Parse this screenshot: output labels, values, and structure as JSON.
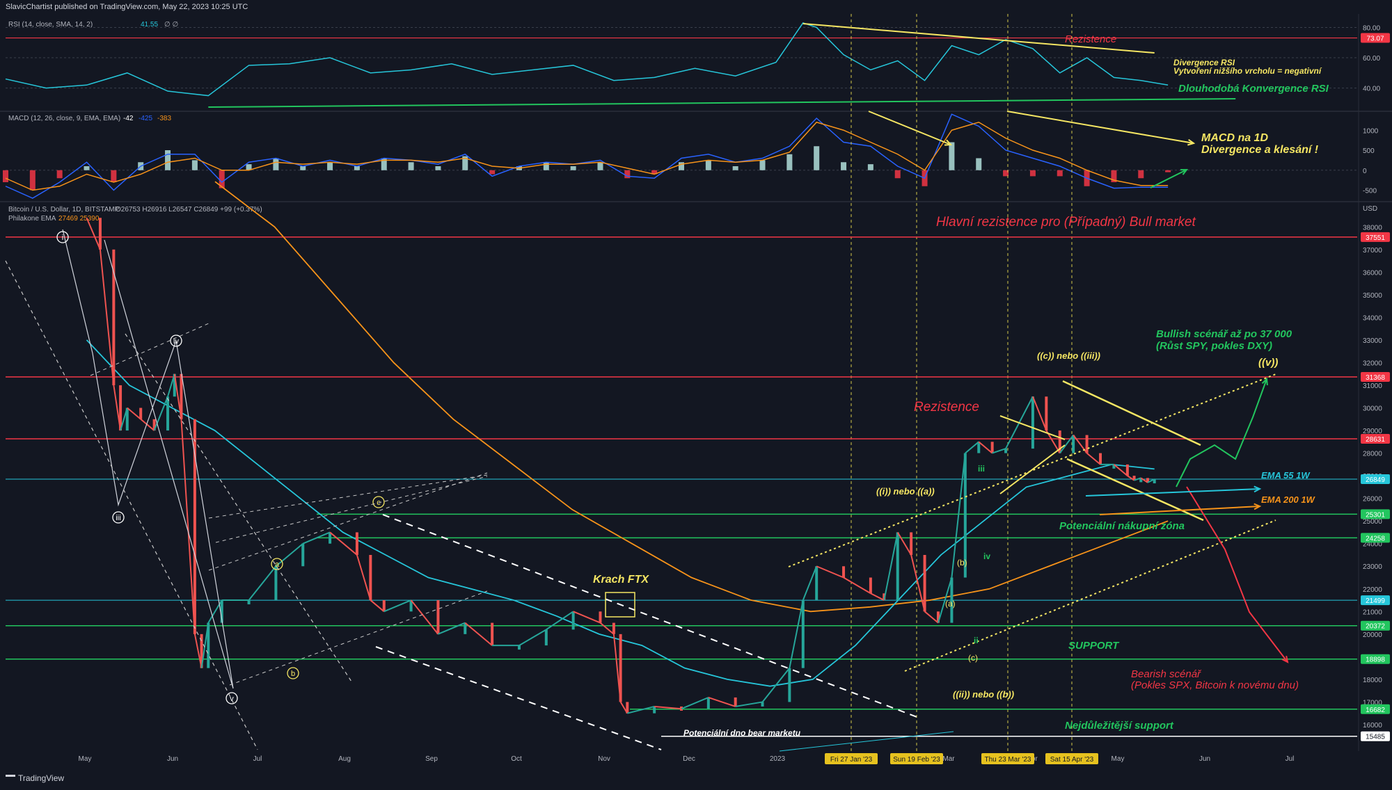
{
  "header": {
    "publisher": "SlavicChartist published on TradingView.com, May 22, 2023 10:25 UTC",
    "brand": "TradingView"
  },
  "colors": {
    "bg": "#131722",
    "red": "#f23645",
    "green": "#22c55e",
    "yellow": "#f5e663",
    "cyan": "#26c6da",
    "orange": "#f7931a",
    "white": "#ffffff",
    "grid": "#2a2e39",
    "text": "#b2b5be"
  },
  "chart_data": [
    {
      "type": "line",
      "panel": "rsi",
      "title": "RSI (14, close, SMA, 14, 2)",
      "value_label": "41.55",
      "extra_label": "∅ ∅",
      "yticks": [
        40,
        60,
        80
      ],
      "ytick_labels": [
        "40.00",
        "60.00",
        "80.00"
      ],
      "ylim": [
        27,
        88
      ],
      "resistance_level": 73.07,
      "resistance_label": "73.07",
      "x": [
        0,
        0.03,
        0.06,
        0.09,
        0.12,
        0.15,
        0.18,
        0.21,
        0.24,
        0.27,
        0.3,
        0.33,
        0.36,
        0.39,
        0.42,
        0.45,
        0.48,
        0.51,
        0.54,
        0.57,
        0.59,
        0.6,
        0.62,
        0.64,
        0.66,
        0.68,
        0.7,
        0.72,
        0.74,
        0.76,
        0.78,
        0.8,
        0.82,
        0.84,
        0.86
      ],
      "values": [
        46,
        40,
        42,
        50,
        38,
        35,
        55,
        56,
        60,
        50,
        52,
        56,
        49,
        52,
        55,
        45,
        47,
        53,
        48,
        57,
        83,
        80,
        62,
        52,
        58,
        45,
        68,
        62,
        72,
        66,
        50,
        60,
        47,
        45,
        42
      ]
    },
    {
      "type": "bar",
      "panel": "macd",
      "title": "MACD (12, 26, close, 9, EMA, EMA)",
      "values_label": [
        "-42",
        "-425",
        "-383"
      ],
      "yticks": [
        1000,
        500,
        0,
        -500
      ],
      "ytick_labels": [
        "1000",
        "500",
        "0",
        "-500"
      ],
      "ylim": [
        -700,
        1300
      ],
      "x": [
        0,
        0.02,
        0.04,
        0.06,
        0.08,
        0.1,
        0.12,
        0.14,
        0.16,
        0.18,
        0.2,
        0.22,
        0.24,
        0.26,
        0.28,
        0.3,
        0.32,
        0.34,
        0.36,
        0.38,
        0.4,
        0.42,
        0.44,
        0.46,
        0.48,
        0.5,
        0.52,
        0.54,
        0.56,
        0.58,
        0.6,
        0.62,
        0.64,
        0.66,
        0.68,
        0.7,
        0.72,
        0.74,
        0.76,
        0.78,
        0.8,
        0.82,
        0.84,
        0.86
      ],
      "histogram": [
        -300,
        -500,
        -200,
        100,
        -300,
        200,
        500,
        250,
        -450,
        150,
        300,
        100,
        200,
        100,
        300,
        200,
        100,
        350,
        -100,
        100,
        200,
        100,
        200,
        -200,
        -100,
        200,
        250,
        100,
        250,
        400,
        600,
        200,
        150,
        -200,
        -400,
        700,
        300,
        -150,
        -150,
        -150,
        -400,
        -300,
        -200,
        -50
      ],
      "macd": [
        -400,
        -700,
        -300,
        200,
        -500,
        100,
        400,
        400,
        -300,
        200,
        300,
        100,
        250,
        100,
        300,
        250,
        150,
        400,
        -150,
        100,
        200,
        150,
        250,
        -150,
        -200,
        300,
        400,
        200,
        300,
        600,
        1300,
        700,
        600,
        100,
        -200,
        1400,
        1100,
        500,
        300,
        100,
        -200,
        -450,
        -425,
        -425
      ],
      "signal": [
        -200,
        -500,
        -400,
        -100,
        -300,
        -100,
        200,
        300,
        0,
        0,
        200,
        150,
        200,
        150,
        250,
        250,
        200,
        300,
        100,
        50,
        150,
        150,
        200,
        50,
        -100,
        150,
        250,
        200,
        250,
        450,
        1200,
        1000,
        700,
        400,
        0,
        1000,
        1200,
        800,
        500,
        300,
        0,
        -250,
        -383,
        -383
      ]
    },
    {
      "type": "line",
      "panel": "price",
      "title": "Bitcoin / U.S. Dollar, 1D, BITSTAMP",
      "ohlc_label": "O26753 H26916 L26547 C26849 +99 (+0.37%)",
      "ema_label": "Philakone EMA",
      "ema_values": "27469 25390",
      "currency": "USD",
      "yticks": [
        16000,
        17000,
        18000,
        19000,
        20000,
        21000,
        22000,
        23000,
        24000,
        25000,
        26000,
        27000,
        28000,
        29000,
        30000,
        31000,
        32000,
        33000,
        34000,
        35000,
        36000,
        37000,
        38000
      ],
      "ylim": [
        15200,
        38500
      ],
      "xticks": [
        "May",
        "Jun",
        "Jul",
        "Aug",
        "Sep",
        "Oct",
        "Nov",
        "Dec",
        "2023",
        "Feb",
        "Mar",
        "Apr",
        "May",
        "Jun",
        "Jul"
      ],
      "date_markers": [
        "Fri 27 Jan '23",
        "Sun 19 Feb '23",
        "Thu 23 Mar '23",
        "Sat 15 Apr '23"
      ],
      "levels": [
        {
          "value": 37551,
          "label": "37551",
          "color": "red"
        },
        {
          "value": 31368,
          "label": "31368",
          "color": "red"
        },
        {
          "value": 28631,
          "label": "28631",
          "color": "red"
        },
        {
          "value": 26849,
          "label": "26849",
          "color": "cyan"
        },
        {
          "value": 25301,
          "label": "25301",
          "color": "green"
        },
        {
          "value": 24258,
          "label": "24258",
          "color": "green"
        },
        {
          "value": 21499,
          "label": "21499",
          "color": "cyan"
        },
        {
          "value": 20372,
          "label": "20372",
          "color": "green"
        },
        {
          "value": 18898,
          "label": "18898",
          "color": "green"
        },
        {
          "value": 16682,
          "label": "16682",
          "color": "green"
        },
        {
          "value": 15485,
          "label": "15485",
          "color": "white"
        }
      ],
      "x": [
        0.06,
        0.07,
        0.08,
        0.085,
        0.09,
        0.1,
        0.11,
        0.12,
        0.125,
        0.13,
        0.14,
        0.145,
        0.15,
        0.16,
        0.18,
        0.2,
        0.22,
        0.24,
        0.26,
        0.27,
        0.28,
        0.3,
        0.32,
        0.34,
        0.36,
        0.38,
        0.4,
        0.42,
        0.44,
        0.45,
        0.455,
        0.46,
        0.48,
        0.5,
        0.52,
        0.54,
        0.56,
        0.58,
        0.59,
        0.6,
        0.62,
        0.64,
        0.65,
        0.66,
        0.67,
        0.68,
        0.69,
        0.7,
        0.71,
        0.72,
        0.73,
        0.74,
        0.76,
        0.77,
        0.78,
        0.79,
        0.8,
        0.81,
        0.82,
        0.83,
        0.835,
        0.84,
        0.845,
        0.85
      ],
      "values": [
        38400,
        37000,
        31000,
        29000,
        30000,
        29500,
        29000,
        30500,
        31500,
        29500,
        20000,
        18500,
        20500,
        21500,
        21500,
        23000,
        24000,
        24500,
        23500,
        21500,
        21000,
        21500,
        20000,
        20500,
        19500,
        19500,
        20200,
        21000,
        20500,
        20000,
        17000,
        16500,
        16800,
        16700,
        17200,
        16800,
        17000,
        18500,
        21500,
        23000,
        22500,
        21800,
        21500,
        24500,
        23500,
        21000,
        20500,
        22500,
        28000,
        28500,
        28000,
        28200,
        30500,
        29000,
        28000,
        28800,
        28000,
        27500,
        27500,
        27000,
        26800,
        26900,
        26700,
        26849
      ],
      "ema55": [
        33000,
        31000,
        30000,
        29000,
        27500,
        26000,
        24500,
        23500,
        22500,
        22000,
        21500,
        20800,
        20000,
        19500,
        18500,
        18000,
        17700,
        18000,
        19500,
        21500,
        23500,
        25000,
        26500,
        27000,
        27500,
        27300
      ],
      "ema200": [
        40000,
        38000,
        35000,
        32000,
        29500,
        27500,
        25500,
        24000,
        22500,
        21500,
        21000,
        21200,
        21500,
        22000,
        23000,
        24000,
        25000
      ]
    }
  ],
  "annotations": {
    "rsi_resistance": "Rezistence",
    "rsi_divergence_1": "Divergence RSI",
    "rsi_divergence_2": "Vytvoření nižšího vrcholu = negativní",
    "rsi_convergence": "Dlouhodobá Konvergence RSI",
    "macd_div_1": "MACD na 1D",
    "macd_div_2": "Divergence a klesání !",
    "main_resistance": "Hlavní rezistence pro (Případný) Bull market",
    "resistance": "Rezistence",
    "bullish_1": "Bullish scénář až po 37 000",
    "bullish_2": "(Růst SPY, pokles DXY)",
    "wave_v": "((v))",
    "wave_c_iii": "((c)) nebo ((iii))",
    "wave_i_a": "((i)) nebo ((a))",
    "wave_ii_b": "((ii)) nebo ((b))",
    "ema55": "EMA 55 1W",
    "ema200": "EMA 200 1W",
    "buy_zone": "Potenciální nákupní zóna",
    "support": "SUPPORT",
    "bearish_1": "Bearish scénář",
    "bearish_2": "(Pokles SPX, Bitcoin k novému dnu)",
    "most_support": "Nejdůležitější support",
    "bear_bottom": "Potenciální dno bear marketu",
    "ftx": "Krach FTX",
    "w_i": "i",
    "w_iii": "iii",
    "w_iv": "iv",
    "w_v": "v",
    "w_a": "a",
    "w_b": "b",
    "w_c": "c",
    "s_b": "(b)",
    "s_a": "(a)",
    "s_c": "(c)",
    "g_iii": "iii",
    "g_iv": "iv",
    "g_ii": "ii"
  }
}
